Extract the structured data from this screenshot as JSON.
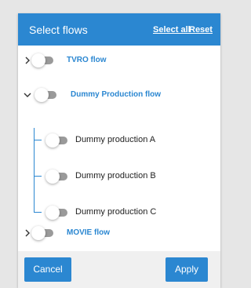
{
  "header": {
    "title": "Select flows",
    "select_all": "Select all",
    "reset": "Reset"
  },
  "flows": [
    {
      "label": "TVRO flow",
      "expanded": false,
      "enabled": false
    },
    {
      "label": "Dummy Production flow",
      "expanded": true,
      "enabled": false,
      "children": [
        {
          "label": "Dummy production A",
          "enabled": false
        },
        {
          "label": "Dummy production B",
          "enabled": false
        },
        {
          "label": "Dummy production C",
          "enabled": false
        }
      ]
    },
    {
      "label": "MOVIE flow",
      "expanded": false,
      "enabled": false
    }
  ],
  "footer": {
    "cancel": "Cancel",
    "apply": "Apply"
  },
  "colors": {
    "accent": "#2b87d1",
    "toggle_off_track": "#9a9a9a"
  },
  "icons": {
    "collapsed": "chevron-right-icon",
    "expanded": "chevron-down-icon"
  }
}
